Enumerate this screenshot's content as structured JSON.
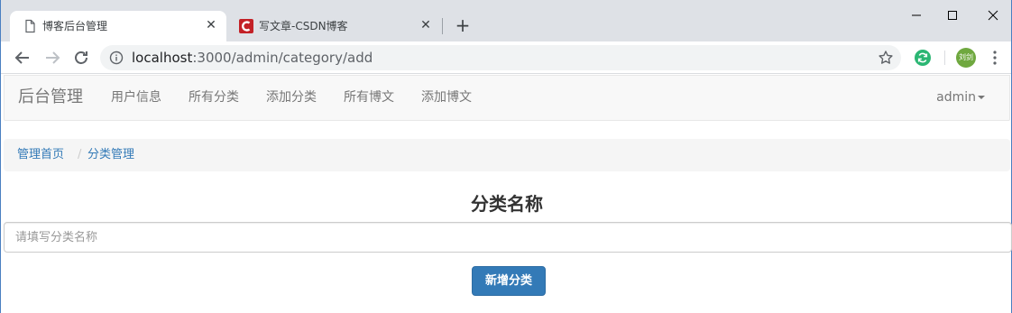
{
  "browser": {
    "tabs": [
      {
        "title": "博客后台管理",
        "active": true
      },
      {
        "title": "写文章-CSDN博客",
        "active": false
      }
    ],
    "address": {
      "host": "localhost",
      "path": ":3000/admin/category/add"
    },
    "profile_initials": "刘剑"
  },
  "navbar": {
    "brand": "后台管理",
    "links": [
      "用户信息",
      "所有分类",
      "添加分类",
      "所有博文",
      "添加博文"
    ],
    "user": "admin"
  },
  "breadcrumb": {
    "items": [
      "管理首页",
      "分类管理"
    ],
    "separator": "/"
  },
  "form": {
    "title": "分类名称",
    "placeholder": "请填写分类名称",
    "value": "",
    "submit_label": "新增分类"
  },
  "colors": {
    "primary": "#337ab7",
    "csdn_red": "#c32127",
    "tab_strip": "#dee1e6"
  },
  "icons": {
    "tab_page": "page-icon",
    "csdn": "csdn-icon",
    "back": "back-arrow-icon",
    "forward": "forward-arrow-icon",
    "reload": "reload-icon",
    "info": "info-icon",
    "bookmark": "star-icon",
    "extension": "sync-extension-icon",
    "menu": "kebab-menu-icon"
  }
}
